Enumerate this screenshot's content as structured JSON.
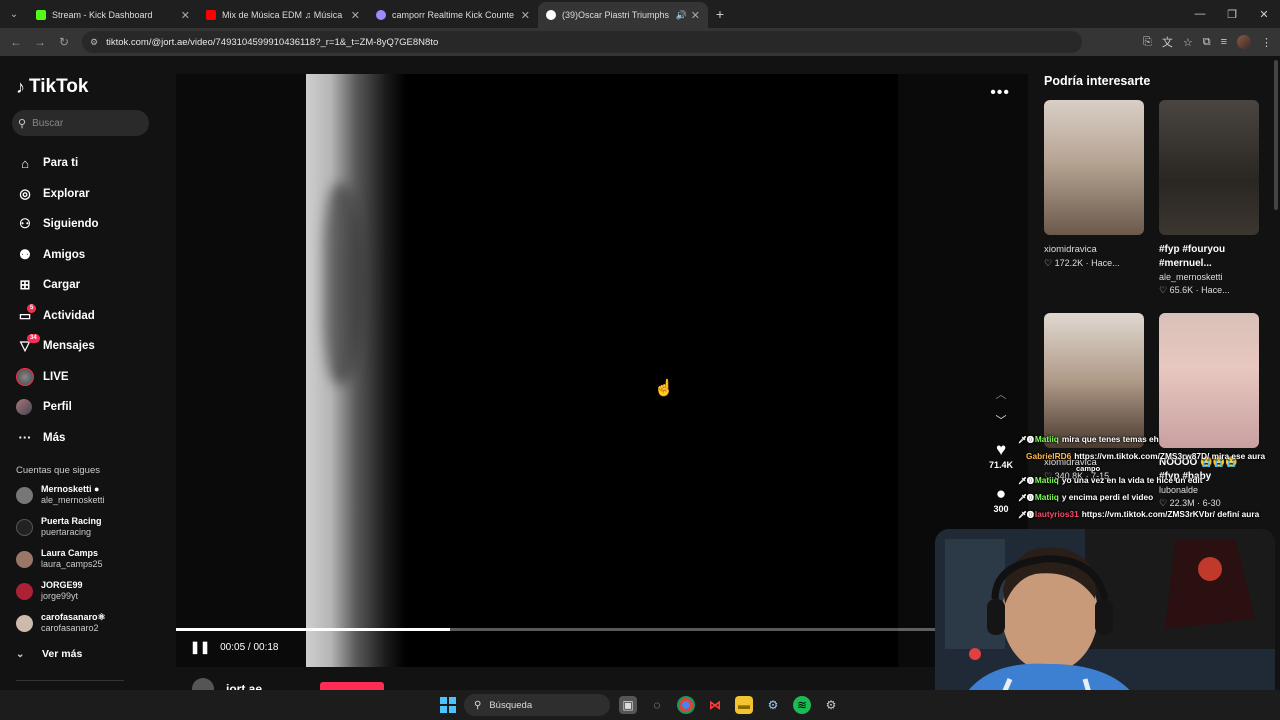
{
  "browser": {
    "tabs": [
      {
        "title": "Stream - Kick Dashboard",
        "favicon_color": "#53fc18",
        "active": false
      },
      {
        "title": "Mix de Música EDM ♫ Música",
        "favicon_color": "#ff0000",
        "active": false
      },
      {
        "title": "camporr Realtime Kick Counte",
        "favicon_color": "#9b8cff",
        "active": false
      },
      {
        "title": "(39)Oscar Piastri Triumphs",
        "favicon_color": "#ffffff",
        "active": true
      }
    ],
    "url": "tiktok.com/@jort.ae/video/7493104599910436118?_r=1&_t=ZM-8yQ7GE8N8to"
  },
  "tiktok": {
    "logo_text": "TikTok",
    "search_placeholder": "Buscar",
    "nav": [
      {
        "label": "Para ti",
        "icon": "home-icon",
        "badge": ""
      },
      {
        "label": "Explorar",
        "icon": "compass-icon",
        "badge": ""
      },
      {
        "label": "Siguiendo",
        "icon": "following-icon",
        "badge": ""
      },
      {
        "label": "Amigos",
        "icon": "friends-icon",
        "badge": ""
      },
      {
        "label": "Cargar",
        "icon": "upload-icon",
        "badge": ""
      },
      {
        "label": "Actividad",
        "icon": "activity-icon",
        "badge": "5"
      },
      {
        "label": "Mensajes",
        "icon": "messages-icon",
        "badge": "34"
      },
      {
        "label": "LIVE",
        "icon": "live-icon",
        "badge": ""
      },
      {
        "label": "Perfil",
        "icon": "profile-icon",
        "badge": ""
      },
      {
        "label": "Más",
        "icon": "more-icon",
        "badge": ""
      }
    ],
    "following_title": "Cuentas que sigues",
    "following": [
      {
        "name": "Mernosketti ●",
        "user": "ale_mernosketti",
        "color": "#777"
      },
      {
        "name": "Puerta Racing",
        "user": "puertaracing",
        "color": "#222"
      },
      {
        "name": "Laura Camps",
        "user": "laura_camps25",
        "color": "#997766"
      },
      {
        "name": "JORGE99",
        "user": "jorge99yt",
        "color": "#aa2233"
      },
      {
        "name": "carofasanaro⚛",
        "user": "carofasanaro2",
        "color": "#ccbbaa"
      }
    ],
    "see_more": "Ver más",
    "player": {
      "time": "00:05 / 00:18",
      "progress": 0.322,
      "likes": "71.4K",
      "comments": "300",
      "author": "jort.ae"
    },
    "recs_title": "Podría interesarte",
    "recs": [
      {
        "caption": "xiomidravica",
        "stats": "♡ 172.2K · Hace...",
        "bold": false,
        "tone": "#c8b8a8"
      },
      {
        "caption": "#fyp #fouryou #mernuel...",
        "user": "ale_mernosketti",
        "stats": "♡ 65.6K · Hace...",
        "bold": true,
        "tone": "#3a3530"
      },
      {
        "caption": "xiomidravica",
        "stats": "♡ 340.8K · 7-15",
        "bold": false,
        "tone": "#bfb0a0"
      },
      {
        "caption": "NOOOO 😭😭😭 #fyp #baby",
        "user": "lubonalde",
        "stats": "♡ 22.3M · 6-30",
        "bold": true,
        "tone": "#d8b8b0"
      }
    ]
  },
  "chat": [
    {
      "user": "Matiiq",
      "msg": "mira que tenes temas eh",
      "color": "#7fff5a"
    },
    {
      "user": "GabrielRD6",
      "msg": "https://vm.tiktok.com/ZMS3rw87D/ mira ese aura",
      "color": "#ffb84a"
    },
    {
      "user": "",
      "msg": "campo",
      "color": "#ffffff"
    },
    {
      "user": "Matiiq",
      "msg": "yo una vez en la vida te hice un edit",
      "color": "#7fff5a"
    },
    {
      "user": "Matiiq",
      "msg": "y encima perdi el video",
      "color": "#7fff5a"
    },
    {
      "user": "lautyrios31",
      "msg": "https://vm.tiktok.com/ZMS3rKVbr/ definí aura",
      "color": "#ff4a6a"
    }
  ],
  "taskbar": {
    "search_label": "Búsqueda"
  }
}
